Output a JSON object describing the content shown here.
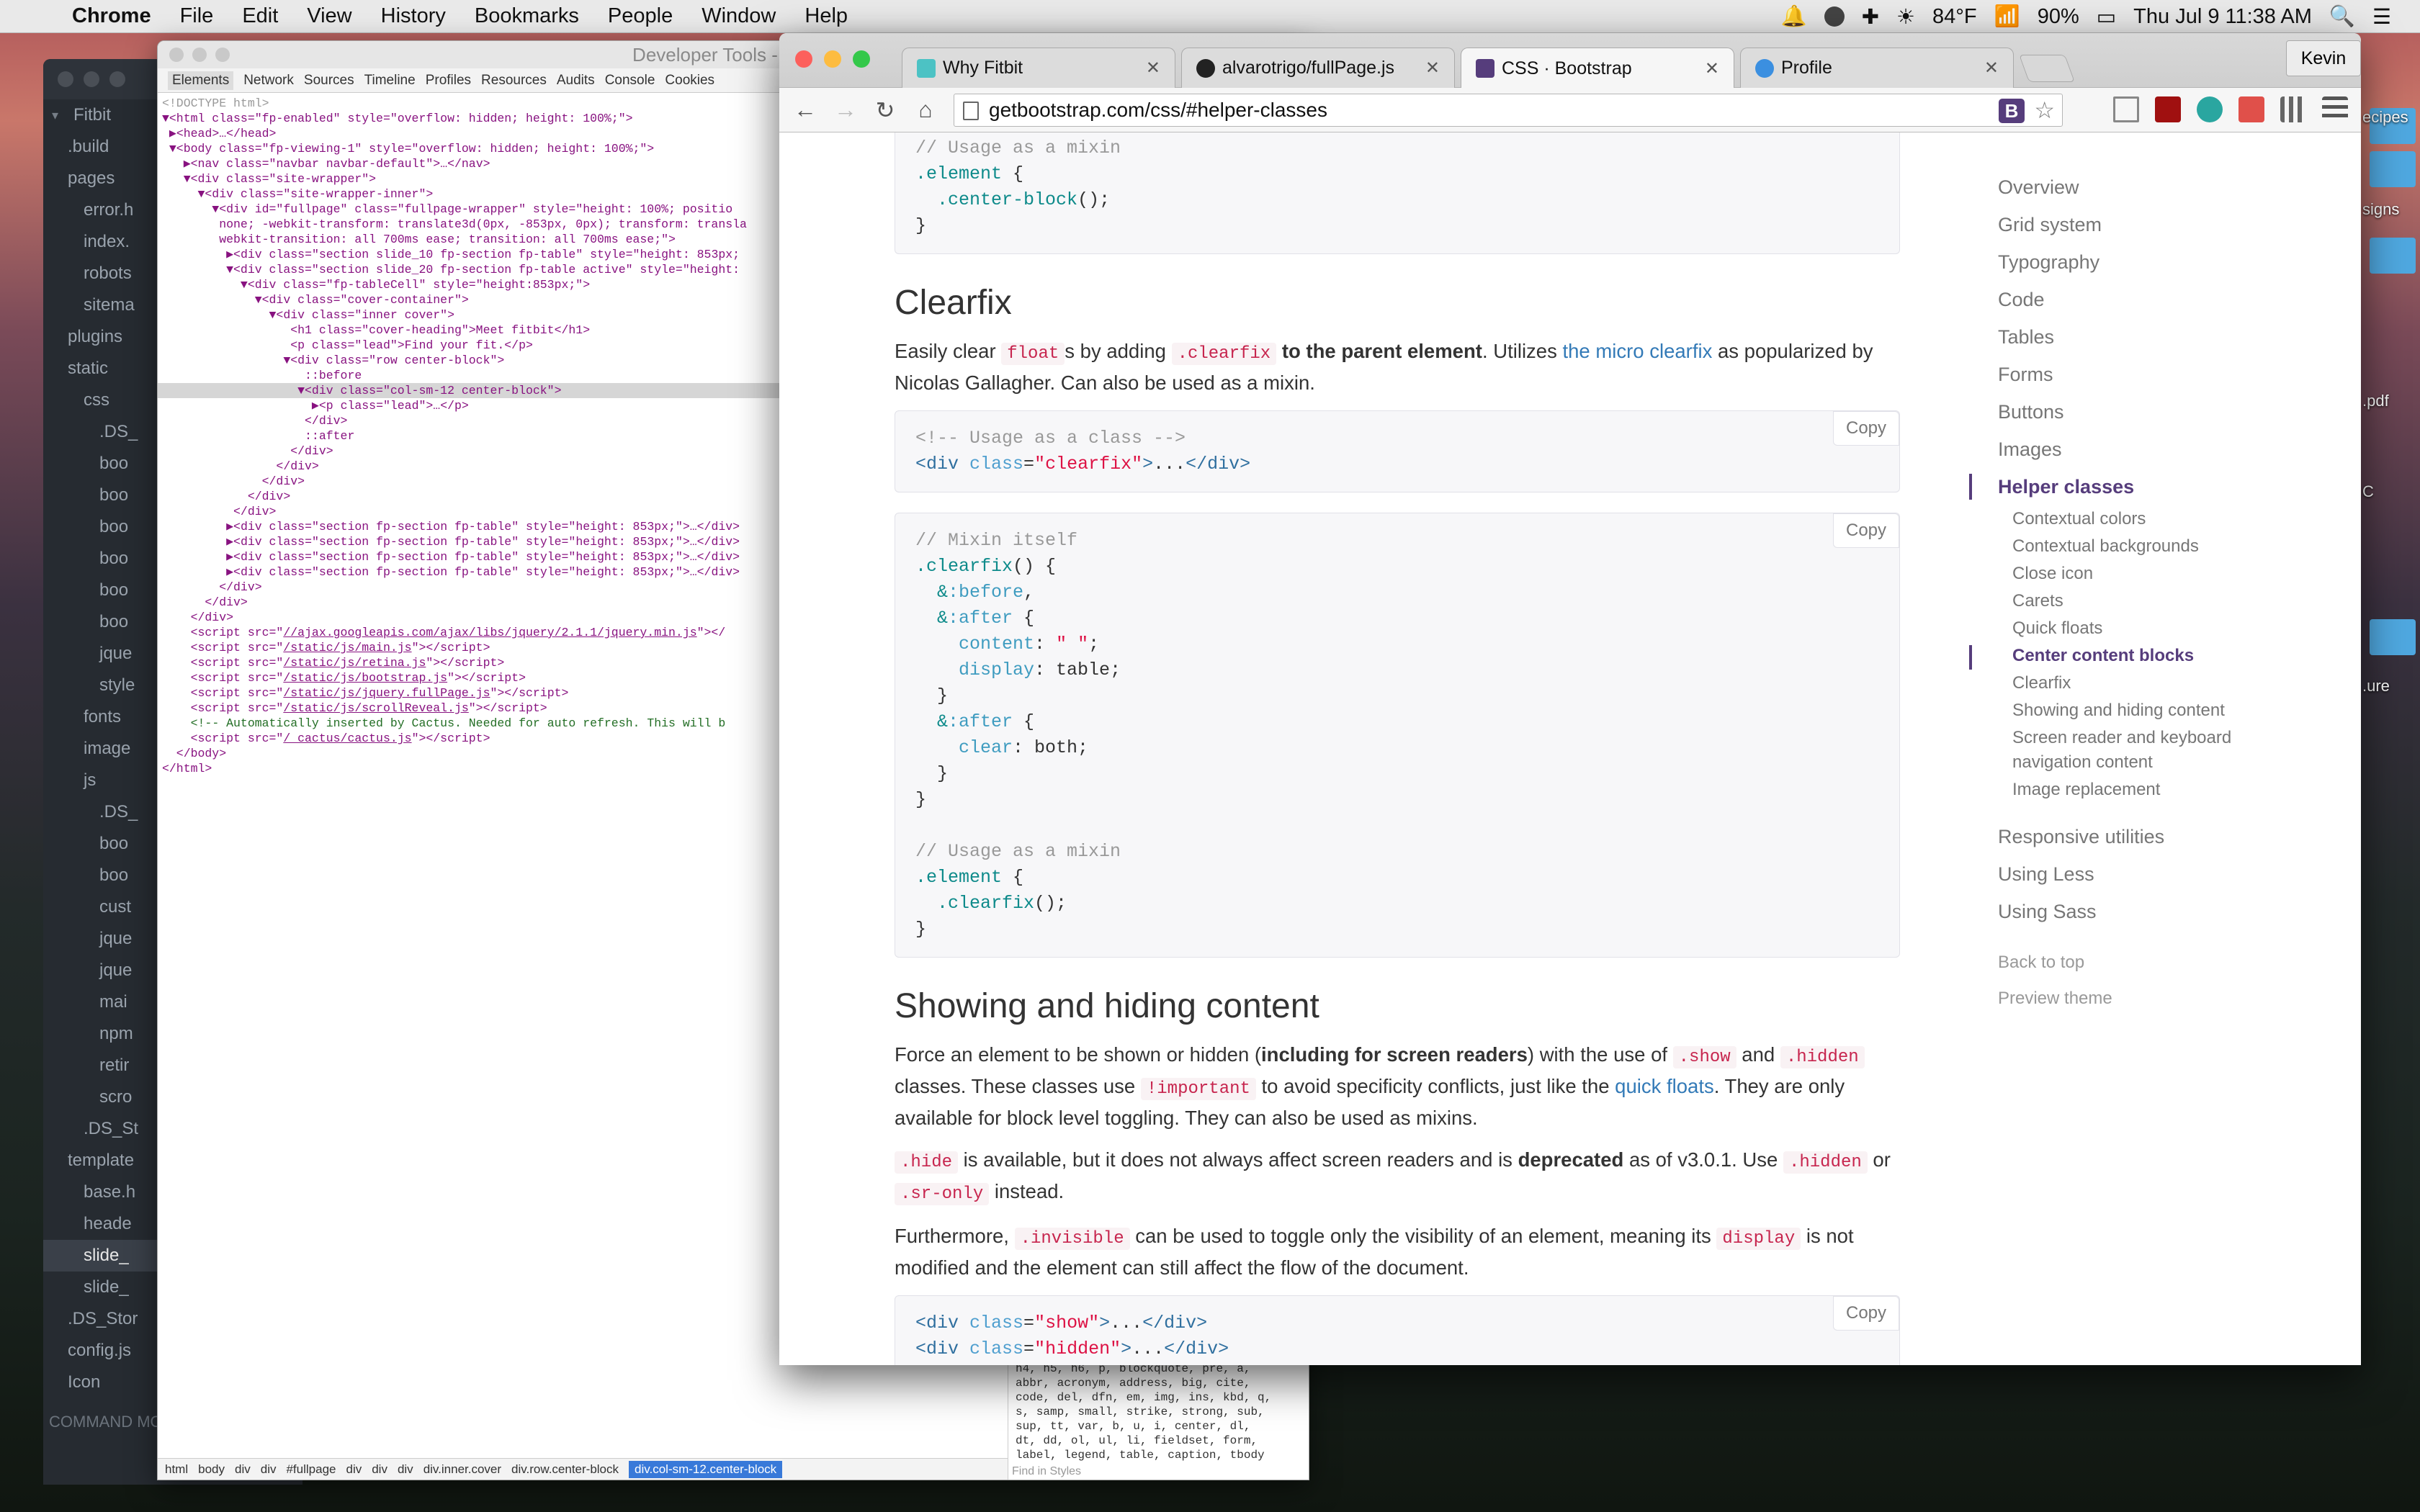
{
  "menubar": {
    "app": "Chrome",
    "items": [
      "File",
      "Edit",
      "View",
      "History",
      "Bookmarks",
      "People",
      "Window",
      "Help"
    ],
    "weather": "84°F",
    "battery": "90%",
    "clock": "Thu Jul 9  11:38 AM"
  },
  "sidebar": {
    "root": "Fitbit",
    "rows": [
      {
        "t": "",
        "l": ".build",
        "d": 1
      },
      {
        "t": "",
        "l": "pages",
        "d": 1
      },
      {
        "t": "",
        "l": "error.h",
        "d": 2
      },
      {
        "t": "",
        "l": "index.",
        "d": 2
      },
      {
        "t": "",
        "l": "robots",
        "d": 2
      },
      {
        "t": "",
        "l": "sitema",
        "d": 2
      },
      {
        "t": "",
        "l": "plugins",
        "d": 1
      },
      {
        "t": "",
        "l": "static",
        "d": 1
      },
      {
        "t": "",
        "l": "css",
        "d": 2
      },
      {
        "t": "",
        "l": ".DS_",
        "d": 3
      },
      {
        "t": "",
        "l": "boo",
        "d": 3
      },
      {
        "t": "",
        "l": "boo",
        "d": 3
      },
      {
        "t": "",
        "l": "boo",
        "d": 3
      },
      {
        "t": "",
        "l": "boo",
        "d": 3
      },
      {
        "t": "",
        "l": "boo",
        "d": 3
      },
      {
        "t": "",
        "l": "boo",
        "d": 3
      },
      {
        "t": "",
        "l": "jque",
        "d": 3
      },
      {
        "t": "",
        "l": "style",
        "d": 3
      },
      {
        "t": "",
        "l": "fonts",
        "d": 2
      },
      {
        "t": "",
        "l": "image",
        "d": 2
      },
      {
        "t": "",
        "l": "js",
        "d": 2
      },
      {
        "t": "",
        "l": ".DS_",
        "d": 3
      },
      {
        "t": "",
        "l": "boo",
        "d": 3
      },
      {
        "t": "",
        "l": "boo",
        "d": 3
      },
      {
        "t": "",
        "l": "cust",
        "d": 3
      },
      {
        "t": "",
        "l": "jque",
        "d": 3
      },
      {
        "t": "",
        "l": "jque",
        "d": 3
      },
      {
        "t": "",
        "l": "mai",
        "d": 3
      },
      {
        "t": "",
        "l": "npm",
        "d": 3
      },
      {
        "t": "",
        "l": "retir",
        "d": 3
      },
      {
        "t": "",
        "l": "scro",
        "d": 3
      },
      {
        "t": "",
        "l": ".DS_St",
        "d": 2
      },
      {
        "t": "",
        "l": "template",
        "d": 1
      },
      {
        "t": "",
        "l": "base.h",
        "d": 2
      },
      {
        "t": "",
        "l": "heade",
        "d": 2
      },
      {
        "t": "",
        "l": "slide_",
        "d": 2
      },
      {
        "t": "",
        "l": "slide_",
        "d": 2
      },
      {
        "t": "",
        "l": ".DS_Stor",
        "d": 1
      },
      {
        "t": "",
        "l": "config.js",
        "d": 1
      },
      {
        "t": "",
        "l": "Icon",
        "d": 1
      }
    ],
    "command": "COMMAND MO"
  },
  "devtools": {
    "title": "Developer Tools - http://l",
    "tabs": [
      "Elements",
      "Network",
      "Sources",
      "Timeline",
      "Profiles",
      "Resources",
      "Audits",
      "Console",
      "Cookies"
    ],
    "crumbs": [
      "html",
      "body",
      "div",
      "div",
      "#fullpage",
      "div",
      "div",
      "div",
      "div.inner.cover",
      "div.row.center-block"
    ],
    "crumb_current": "div.col-sm-12.center-block",
    "find": "Find in Styles",
    "styles_text": "h4, h5, h6, p, blockquote, pre, a,\nabbr, acronym, address, big, cite,\ncode, del, dfn, em, img, ins, kbd, q,\ns, samp, small, strike, strong, sub,\nsup, tt, var, b, u, i, center, dl,\ndt, dd, ol, ul, li, fieldset, form,\nlabel, legend, table, caption, tbody"
  },
  "right_strip": [
    "ecipes",
    "signs",
    ".pdf",
    "C",
    ".ure"
  ],
  "chrome": {
    "tabs": [
      {
        "title": "Why Fitbit"
      },
      {
        "title": "alvarotrigo/fullPage.js"
      },
      {
        "title": "CSS · Bootstrap"
      },
      {
        "title": "Profile"
      }
    ],
    "profile": "Kevin",
    "url": "getbootstrap.com/css/#helper-classes"
  },
  "content": {
    "copy_label": "Copy",
    "clearfix_heading": "Clearfix",
    "showing_heading": "Showing and hiding content"
  },
  "sidenav": {
    "items": [
      "Overview",
      "Grid system",
      "Typography",
      "Code",
      "Tables",
      "Forms",
      "Buttons",
      "Images",
      "Helper classes"
    ],
    "sub": [
      "Contextual colors",
      "Contextual backgrounds",
      "Close icon",
      "Carets",
      "Quick floats",
      "Center content blocks",
      "Clearfix",
      "Showing and hiding content",
      "Screen reader and keyboard navigation content",
      "Image replacement"
    ],
    "after": [
      "Responsive utilities",
      "Using Less",
      "Using Sass"
    ],
    "back_to_top": "Back to top",
    "preview_theme": "Preview theme"
  }
}
